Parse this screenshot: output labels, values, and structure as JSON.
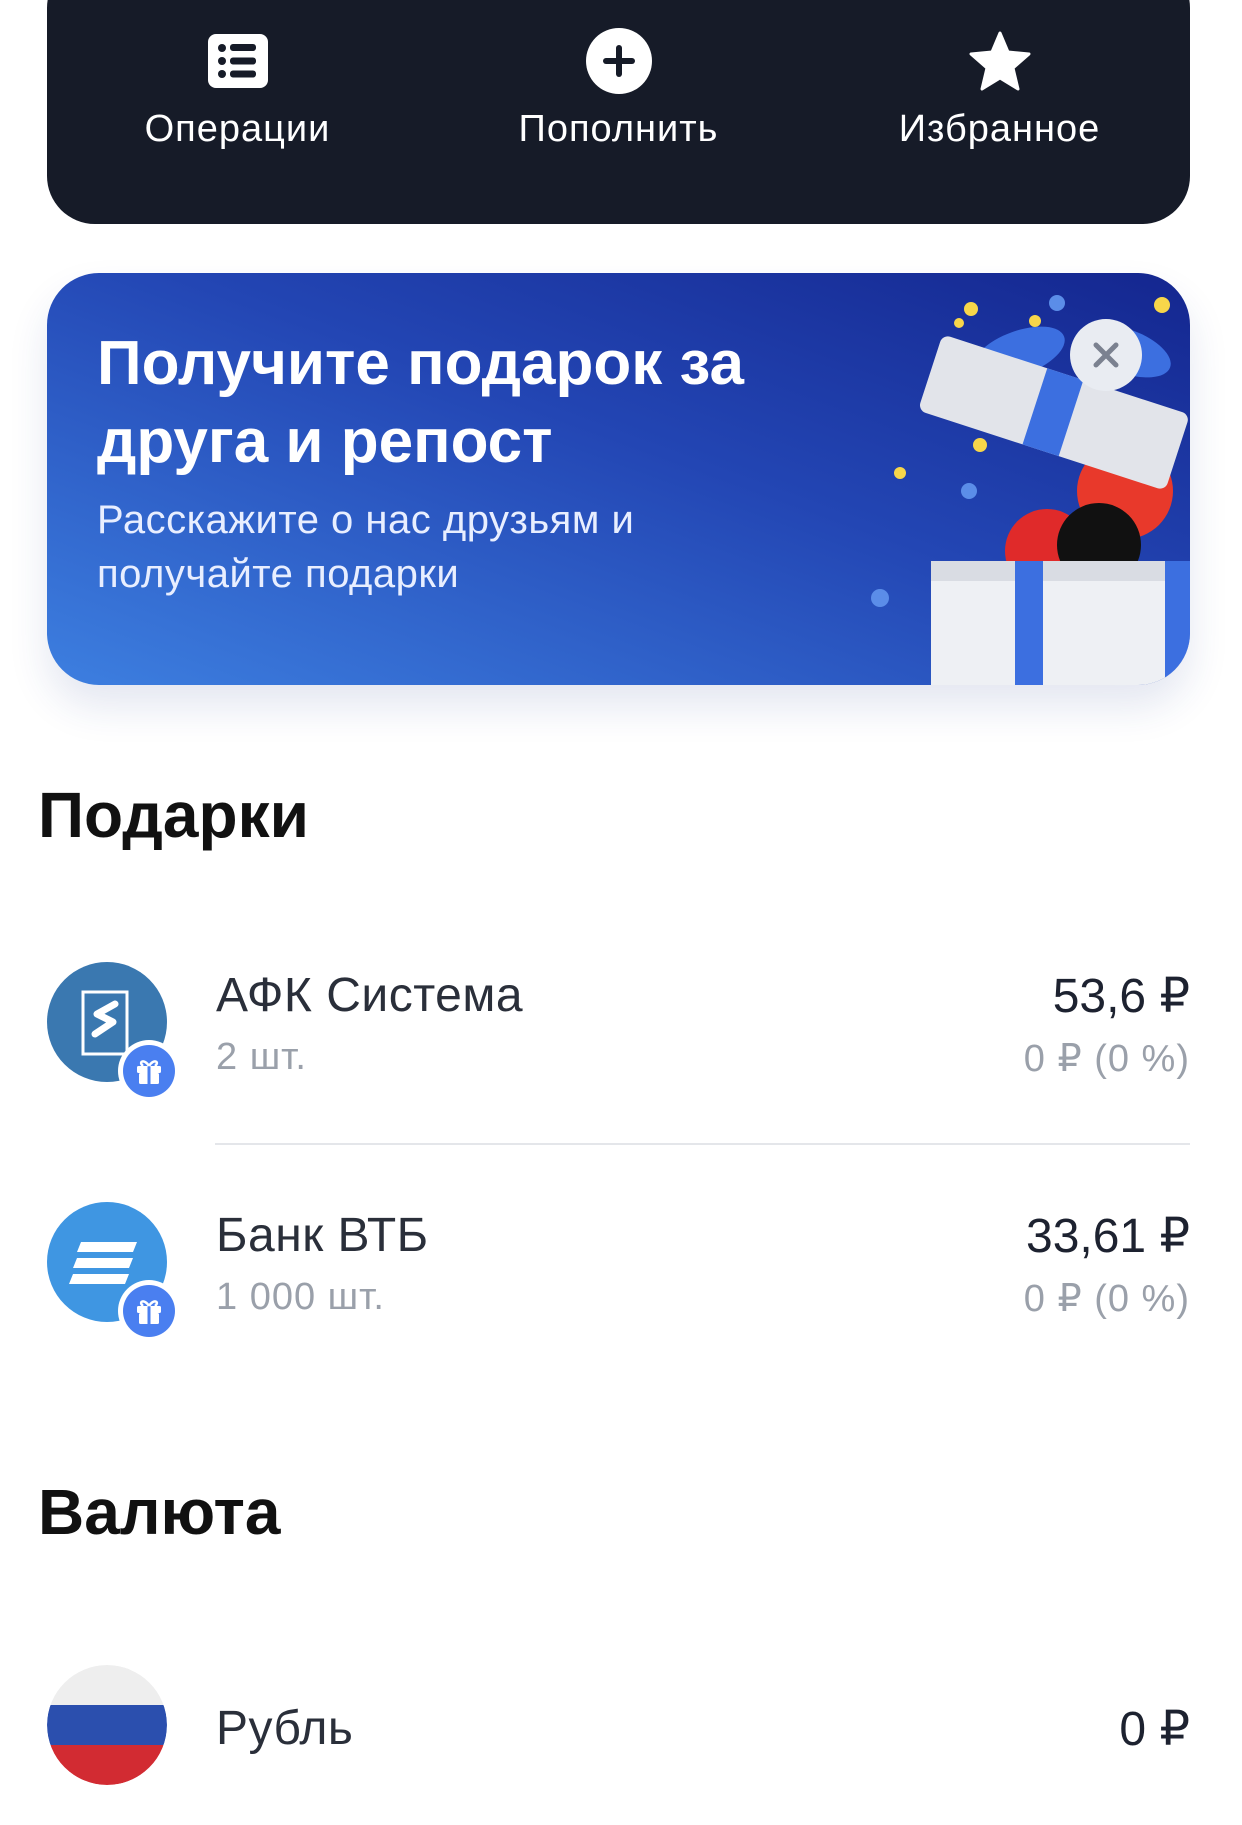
{
  "actions": [
    {
      "label": "Операции",
      "icon": "list-icon"
    },
    {
      "label": "Пополнить",
      "icon": "plus-circle-icon"
    },
    {
      "label": "Избранное",
      "icon": "star-icon"
    }
  ],
  "promo": {
    "title": "Получите подарок за друга и репост",
    "subtitle": "Расскажите о нас друзьям и получайте подарки"
  },
  "gifts_section": {
    "title": "Подарки",
    "items": [
      {
        "name": "АФК Система",
        "quantity": "2 шт.",
        "value": "53,6 ₽",
        "change": "0 ₽ (0 %)",
        "icon": "sistema-logo",
        "color": "#3a78b0"
      },
      {
        "name": "Банк ВТБ",
        "quantity": "1 000 шт.",
        "value": "33,61 ₽",
        "change": "0 ₽ (0 %)",
        "icon": "vtb-logo",
        "color": "#3f96e2"
      }
    ]
  },
  "currency_section": {
    "title": "Валюта",
    "items": [
      {
        "name": "Рубль",
        "value": "0 ₽",
        "icon": "russia-flag-icon"
      }
    ]
  }
}
